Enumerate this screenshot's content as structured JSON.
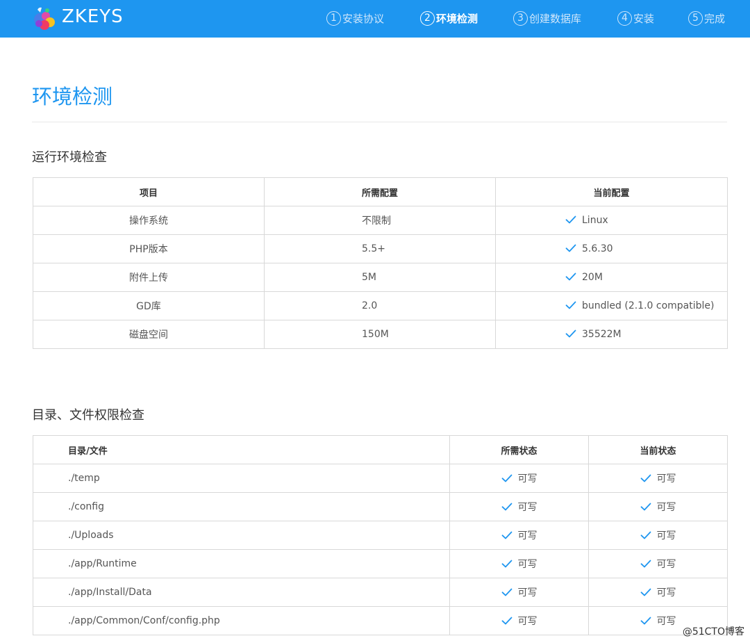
{
  "header": {
    "brand": "ZKEYS",
    "steps": [
      {
        "num": "1",
        "label": "安装协议",
        "active": false
      },
      {
        "num": "2",
        "label": "环境检测",
        "active": true
      },
      {
        "num": "3",
        "label": "创建数据库",
        "active": false
      },
      {
        "num": "4",
        "label": "安装",
        "active": false
      },
      {
        "num": "5",
        "label": "完成",
        "active": false
      }
    ]
  },
  "page": {
    "title": "环境检测"
  },
  "env_section": {
    "title": "运行环境检查",
    "headers": [
      "项目",
      "所需配置",
      "当前配置"
    ],
    "rows": [
      {
        "item": "操作系统",
        "required": "不限制",
        "current": "Linux"
      },
      {
        "item": "PHP版本",
        "required": "5.5+",
        "current": "5.6.30"
      },
      {
        "item": "附件上传",
        "required": "5M",
        "current": "20M"
      },
      {
        "item": "GD库",
        "required": "2.0",
        "current": "bundled (2.1.0 compatible)"
      },
      {
        "item": "磁盘空间",
        "required": "150M",
        "current": "35522M"
      }
    ]
  },
  "dir_section": {
    "title": "目录、文件权限检查",
    "headers": [
      "目录/文件",
      "所需状态",
      "当前状态"
    ],
    "rows": [
      {
        "path": "./temp",
        "required": "可写",
        "current": "可写"
      },
      {
        "path": "./config",
        "required": "可写",
        "current": "可写"
      },
      {
        "path": "./Uploads",
        "required": "可写",
        "current": "可写"
      },
      {
        "path": "./app/Runtime",
        "required": "可写",
        "current": "可写"
      },
      {
        "path": "./app/Install/Data",
        "required": "可写",
        "current": "可写"
      },
      {
        "path": "./app/Common/Conf/config.php",
        "required": "可写",
        "current": "可写"
      }
    ]
  },
  "watermark": "@51CTO博客",
  "icons": {
    "status": "check-icon",
    "logo": "zkeys-logo-icon"
  },
  "colors": {
    "accent": "#1e96f0",
    "check": "#1e96f0"
  }
}
